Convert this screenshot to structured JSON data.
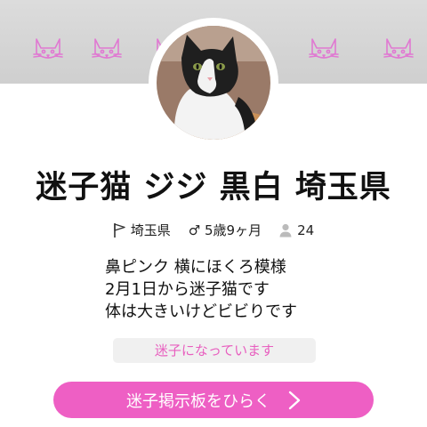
{
  "profile": {
    "title": "迷子猫 ジジ 黒白 埼玉県",
    "location": "埼玉県",
    "gender_age": "♂ 5歳9ヶ月",
    "followers": "24",
    "description_lines": [
      "鼻ピンク 横にほくろ模様",
      "2月1日から迷子猫です",
      "体は大きいけどビビりです"
    ]
  },
  "status_label": "迷子になっています",
  "cta_label": "迷子掲示板をひらく",
  "icons": {
    "banner_decoration": "cat-face-icon",
    "location": "flag-icon",
    "followers": "person-icon",
    "cta": "chevron-right-icon"
  },
  "colors": {
    "accent": "#ee5fc4",
    "status_text": "#e85fbf",
    "banner": "#d5d5d5",
    "cat_line": "#e079d2"
  }
}
